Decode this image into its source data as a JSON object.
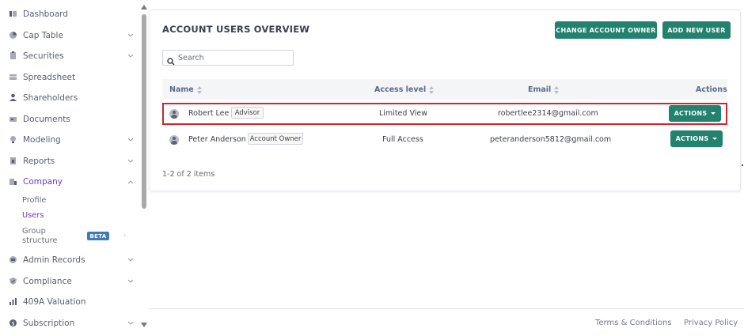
{
  "sidebar": {
    "items": [
      {
        "label": "Dashboard",
        "icon": "dashboard-icon",
        "chevron": false
      },
      {
        "label": "Cap Table",
        "icon": "pie-chart-icon",
        "chevron": true
      },
      {
        "label": "Securities",
        "icon": "clipboard-icon",
        "chevron": true
      },
      {
        "label": "Spreadsheet",
        "icon": "spreadsheet-icon",
        "chevron": false
      },
      {
        "label": "Shareholders",
        "icon": "person-icon",
        "chevron": false
      },
      {
        "label": "Documents",
        "icon": "folder-icon",
        "chevron": false
      },
      {
        "label": "Modeling",
        "icon": "lightbulb-icon",
        "chevron": true
      },
      {
        "label": "Reports",
        "icon": "report-icon",
        "chevron": true
      },
      {
        "label": "Company",
        "icon": "building-icon",
        "chevron": true,
        "active": true
      },
      {
        "label": "Admin Records",
        "icon": "records-icon",
        "chevron": true
      },
      {
        "label": "Compliance",
        "icon": "shield-icon",
        "chevron": true
      },
      {
        "label": "409A Valuation",
        "icon": "valuation-icon",
        "chevron": false
      },
      {
        "label": "Subscription",
        "icon": "dollar-icon",
        "chevron": true
      }
    ],
    "company_sub": {
      "profile": "Profile",
      "users": "Users",
      "group_line1": "Group",
      "group_line2": "structure",
      "beta": "BETA"
    }
  },
  "card": {
    "title": "ACCOUNT USERS OVERVIEW",
    "change_owner_label": "CHANGE ACCOUNT OWNER",
    "add_user_label": "ADD NEW USER",
    "search_placeholder": "Search",
    "columns": {
      "name": "Name",
      "access": "Access level",
      "email": "Email",
      "actions": "Actions"
    },
    "rows": [
      {
        "name": "Robert Lee",
        "role": "Advisor",
        "access": "Limited View",
        "email": "robertlee2314@gmail.com",
        "action": "ACTIONS"
      },
      {
        "name": "Peter Anderson",
        "role": "Account Owner",
        "access": "Full Access",
        "email": "peteranderson5812@gmail.com",
        "action": "ACTIONS"
      }
    ],
    "pager": "1-2 of 2 items"
  },
  "footer": {
    "terms": "Terms & Conditions",
    "privacy": "Privacy Policy"
  },
  "colors": {
    "accent": "#22826e",
    "active_nav": "#6b3bc6",
    "highlight_border": "#c8282e",
    "beta_badge": "#3e7bb8"
  }
}
